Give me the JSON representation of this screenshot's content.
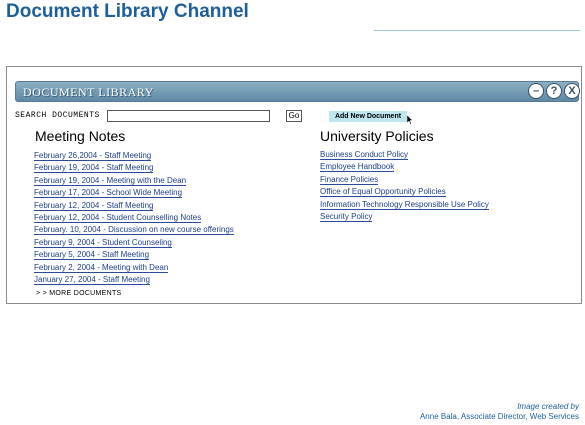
{
  "page": {
    "title": "Document Library Channel"
  },
  "portlet": {
    "title": "DOCUMENT LIBRARY",
    "controls": [
      {
        "icon": "minimize-icon",
        "glyph": "–"
      },
      {
        "icon": "help-icon",
        "glyph": "?"
      },
      {
        "icon": "close-icon",
        "glyph": "X"
      }
    ]
  },
  "search": {
    "label": "SEARCH DOCUMENTS",
    "value": "",
    "button": "Go"
  },
  "add_document": {
    "label": "Add New Document"
  },
  "meeting_notes": {
    "heading": "Meeting Notes",
    "items": [
      "February 26,2004 - Staff Meeting",
      "February 19, 2004 - Staff Meeting",
      "February 19, 2004 - Meeting with the Dean",
      "February 17, 2004 - School Wide Meeting",
      "February 12, 2004 - Staff Meeting",
      "February 12, 2004 - Student Counselling Notes",
      "February. 10, 2004 - Discussion on new course offerings",
      "February 9, 2004 - Student Counseling",
      "February 5, 2004 - Staff Meeting",
      "February 2, 2004 - Meeting with Dean",
      "January 27, 2004 - Staff Meeting"
    ],
    "more": "> > MORE DOCUMENTS"
  },
  "university_policies": {
    "heading": "University Policies",
    "items": [
      "Business Conduct Policy",
      "Employee Handbook",
      "Finance Policies",
      "Office of Equal Opportunity Policies",
      "Information Technology Responsible Use Policy",
      "Security Policy"
    ]
  },
  "credit": {
    "line1": "Image created by",
    "line2": "Anne Bala, Associate Director, Web Services"
  }
}
